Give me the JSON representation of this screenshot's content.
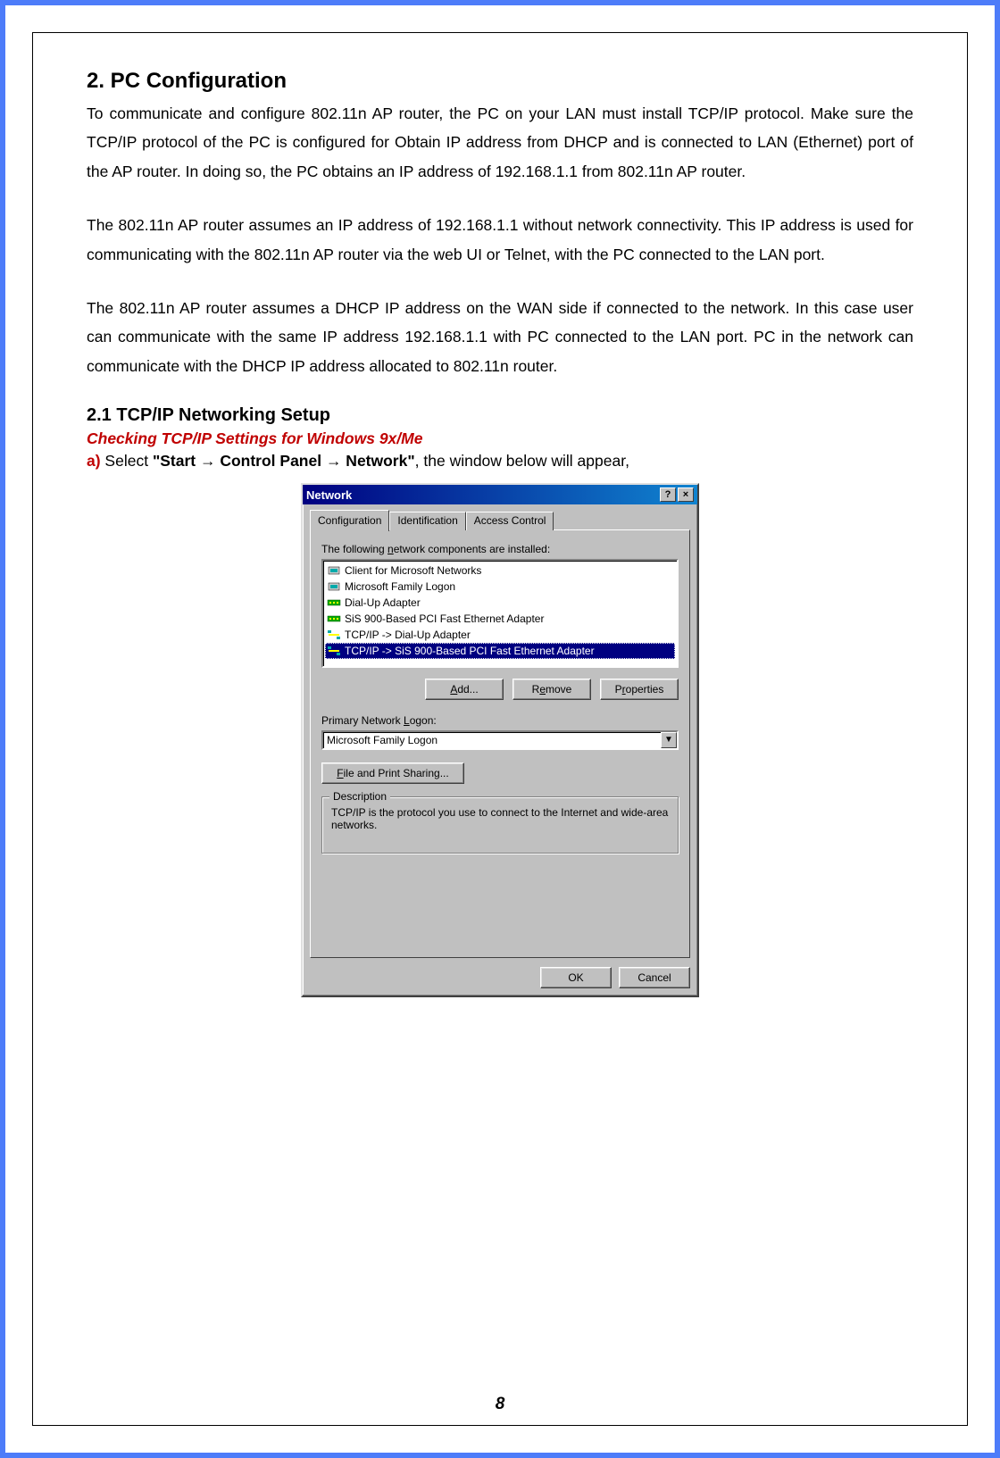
{
  "section": {
    "heading": "2. PC Configuration",
    "para1": "To communicate and configure 802.11n AP router, the PC on your LAN must install TCP/IP protocol. Make sure the TCP/IP protocol of the PC is configured for Obtain IP address from DHCP and is connected to LAN (Ethernet) port of the AP router. In doing so, the PC obtains an IP address of 192.168.1.1 from 802.11n AP router.",
    "para2": "The 802.11n AP router assumes an IP address of 192.168.1.1 without network connectivity. This IP address is used for communicating with the 802.11n AP router via the web UI or Telnet, with the PC connected to the LAN port.",
    "para3": "The 802.11n AP router assumes a DHCP IP address on the WAN side if connected to the network. In this case user can communicate with the same IP address 192.168.1.1 with PC connected to the LAN port. PC in the network can communicate with the DHCP IP address allocated to 802.11n router.",
    "sub": "2.1 TCP/IP Networking Setup",
    "redline": "Checking TCP/IP Settings for Windows 9x/Me",
    "step_a_lead": "a)",
    "step_a_pre": " Select ",
    "step_a_bold": "\"Start → Control Panel → Network\"",
    "step_a_post": ", the window below will appear,"
  },
  "dlg": {
    "title": "Network",
    "help_btn": "?",
    "close_btn": "×",
    "tabs": [
      "Configuration",
      "Identification",
      "Access Control"
    ],
    "list_label": "The following network components are installed:",
    "items": [
      {
        "icon": "client",
        "label": "Client for Microsoft Networks"
      },
      {
        "icon": "client",
        "label": "Microsoft Family Logon"
      },
      {
        "icon": "adapter",
        "label": "Dial-Up Adapter"
      },
      {
        "icon": "adapter",
        "label": "SiS 900-Based PCI Fast Ethernet Adapter"
      },
      {
        "icon": "protocol",
        "label": "TCP/IP -> Dial-Up Adapter"
      },
      {
        "icon": "protocol",
        "label": "TCP/IP -> SiS 900-Based PCI Fast Ethernet Adapter"
      }
    ],
    "selected_index": 5,
    "btn_add": "Add...",
    "btn_remove": "Remove",
    "btn_props": "Properties",
    "logon_label": "Primary Network Logon:",
    "logon_value": "Microsoft Family Logon",
    "fps_btn": "File and Print Sharing...",
    "desc_legend": "Description",
    "desc_text": "TCP/IP is the protocol you use to connect to the Internet and wide-area networks.",
    "ok": "OK",
    "cancel": "Cancel"
  },
  "page_number": "8"
}
